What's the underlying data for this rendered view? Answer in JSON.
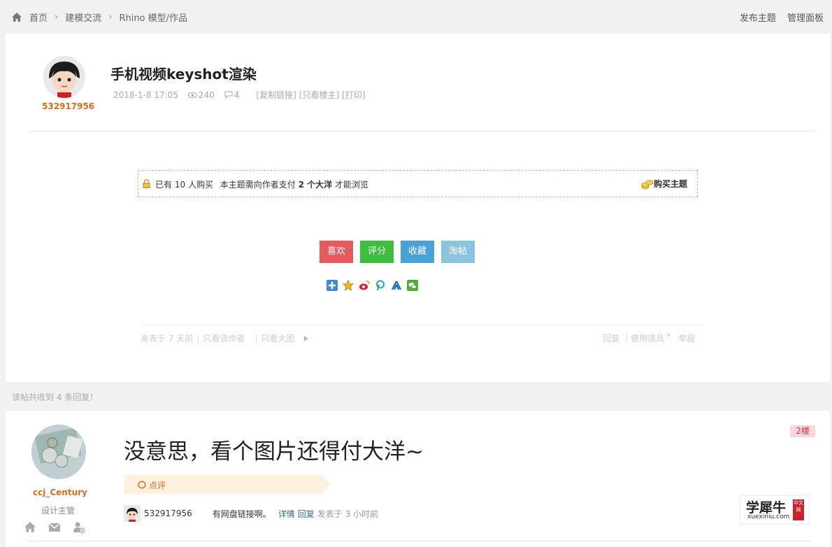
{
  "breadcrumb": {
    "home": "首页",
    "forum": "建模交流",
    "board": "Rhino 模型/作品",
    "sep": "›"
  },
  "topnav": {
    "post": "发布主题",
    "admin": "管理面板"
  },
  "thread": {
    "author": "532917956",
    "title": "手机视频keyshot渲染",
    "date": "2018-1-8 17:05",
    "views": "240",
    "replies": "4",
    "copy_link": "[复制链接]",
    "only_op": "[只看楼主]",
    "print": "[打印]"
  },
  "paywall": {
    "bought_prefix": "已有",
    "bought_count": "10",
    "bought_suffix": "人购买",
    "need_prefix": "本主题需向作者支付",
    "amount": "2 个大洋",
    "need_suffix": "才能浏览",
    "buy": "购买主题"
  },
  "actions": [
    {
      "label": "喜欢",
      "color": "#e8595d"
    },
    {
      "label": "评分",
      "color": "#3cbf3c"
    },
    {
      "label": "收藏",
      "color": "#4aa1d8"
    },
    {
      "label": "淘帖",
      "color": "#8cc4e0"
    }
  ],
  "share_icons": [
    "qzone-icon",
    "favorite-star-icon",
    "weibo-icon",
    "pinterest-icon",
    "renren-icon",
    "wechat-icon"
  ],
  "post_footer": {
    "posted": "发表于 7 天前",
    "only_author": "只看该作者",
    "only_images": "只看大图",
    "reply": "回复",
    "tools": "使用道具",
    "report": "举报"
  },
  "reply_count_text": "该帖共收到 4 条回复！",
  "reply": {
    "user": "ccj_Century",
    "role": "设计主管",
    "floor": "2楼",
    "message": "没意思，看个图片还得付大洋~",
    "comment_label": "点评",
    "comment": {
      "user": "532917956",
      "text": "有网盘链接啊。",
      "detail": "详情",
      "reply": "回复",
      "time": "发表于 3 小时前"
    }
  },
  "watermark": {
    "big": "学犀牛",
    "small": "xuexiniu.com",
    "tag": "中文网"
  }
}
